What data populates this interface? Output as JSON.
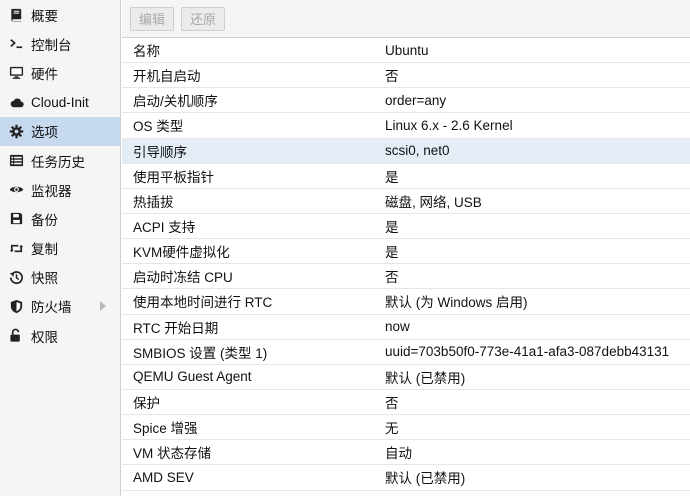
{
  "sidebar": {
    "items": [
      {
        "label": "概要",
        "icon": "book-icon",
        "selected": false
      },
      {
        "label": "控制台",
        "icon": "terminal-icon",
        "selected": false
      },
      {
        "label": "硬件",
        "icon": "desktop-icon",
        "selected": false
      },
      {
        "label": "Cloud-Init",
        "icon": "cloud-icon",
        "selected": false
      },
      {
        "label": "选项",
        "icon": "gear-icon",
        "selected": true
      },
      {
        "label": "任务历史",
        "icon": "list-icon",
        "selected": false
      },
      {
        "label": "监视器",
        "icon": "eye-icon",
        "selected": false
      },
      {
        "label": "备份",
        "icon": "floppy-icon",
        "selected": false
      },
      {
        "label": "复制",
        "icon": "retweet-icon",
        "selected": false
      },
      {
        "label": "快照",
        "icon": "history-icon",
        "selected": false
      },
      {
        "label": "防火墙",
        "icon": "shield-icon",
        "selected": false,
        "has_arrow": true
      },
      {
        "label": "权限",
        "icon": "unlock-icon",
        "selected": false
      }
    ]
  },
  "toolbar": {
    "edit_label": "编辑",
    "revert_label": "还原"
  },
  "options": {
    "selected_index": 4,
    "rows": [
      {
        "name": "名称",
        "value": "Ubuntu"
      },
      {
        "name": "开机自启动",
        "value": "否"
      },
      {
        "name": "启动/关机顺序",
        "value": "order=any"
      },
      {
        "name": "OS 类型",
        "value": "Linux 6.x - 2.6 Kernel"
      },
      {
        "name": "引导顺序",
        "value": "scsi0, net0"
      },
      {
        "name": "使用平板指针",
        "value": "是"
      },
      {
        "name": "热插拔",
        "value": "磁盘, 网络, USB"
      },
      {
        "name": "ACPI 支持",
        "value": "是"
      },
      {
        "name": "KVM硬件虚拟化",
        "value": "是"
      },
      {
        "name": "启动时冻结 CPU",
        "value": "否"
      },
      {
        "name": "使用本地时间进行 RTC",
        "value": "默认 (为 Windows 启用)"
      },
      {
        "name": "RTC 开始日期",
        "value": "now"
      },
      {
        "name": "SMBIOS 设置 (类型 1)",
        "value": "uuid=703b50f0-773e-41a1-afa3-087debb43131"
      },
      {
        "name": "QEMU Guest Agent",
        "value": "默认 (已禁用)"
      },
      {
        "name": "保护",
        "value": "否"
      },
      {
        "name": "Spice 增强",
        "value": "无"
      },
      {
        "name": "VM 状态存储",
        "value": "自动"
      },
      {
        "name": "AMD SEV",
        "value": "默认 (已禁用)"
      }
    ]
  },
  "colors": {
    "sidebar_bg": "#f5f5f5",
    "sidebar_selected": "#c6d9ee",
    "row_selected": "#e4edf6",
    "border": "#d0d0d0"
  }
}
